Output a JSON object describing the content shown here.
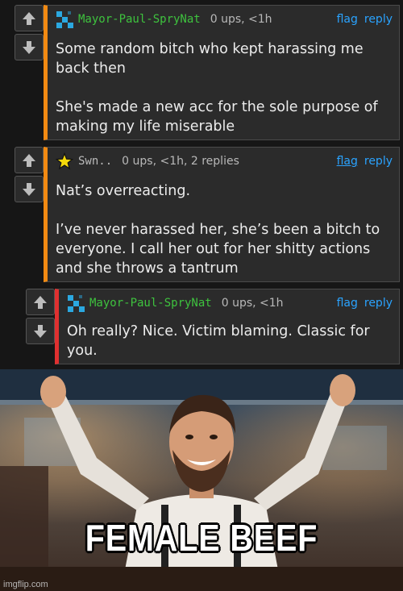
{
  "comments": [
    {
      "username": "Mayor-Paul-SpryNat",
      "username_color": "#3ec23e",
      "avatar_icon": "pixel-avatar-icon",
      "stats": "0 ups, <1h",
      "flag_label": "flag",
      "reply_label": "reply",
      "body": [
        "Some random bitch who kept harassing me back then",
        "She's made a new acc for the sole purpose of making my life miserable"
      ]
    },
    {
      "username": "Swn..",
      "username_color": "#bbbbbb",
      "avatar_icon": "star-icon",
      "stats": "0 ups, <1h, 2 replies",
      "flag_label": "flag",
      "reply_label": "reply",
      "body": [
        "Nat’s overreacting.",
        "I’ve never harassed her, she’s been a bitch to everyone. I call her out for her shitty actions and she throws a tantrum"
      ]
    },
    {
      "username": "Mayor-Paul-SpryNat",
      "username_color": "#3ec23e",
      "avatar_icon": "pixel-avatar-icon",
      "stats": "0 ups, <1h",
      "flag_label": "flag",
      "reply_label": "reply",
      "body": [
        "Oh really? Nice. Victim blaming. Classic for you."
      ]
    }
  ],
  "meme": {
    "caption": "FEMALE BEEF",
    "watermark": "imgflip.com"
  },
  "colors": {
    "link": "#2aa3ff",
    "orange_bar": "#f28a12",
    "red_bar": "#e03030"
  }
}
